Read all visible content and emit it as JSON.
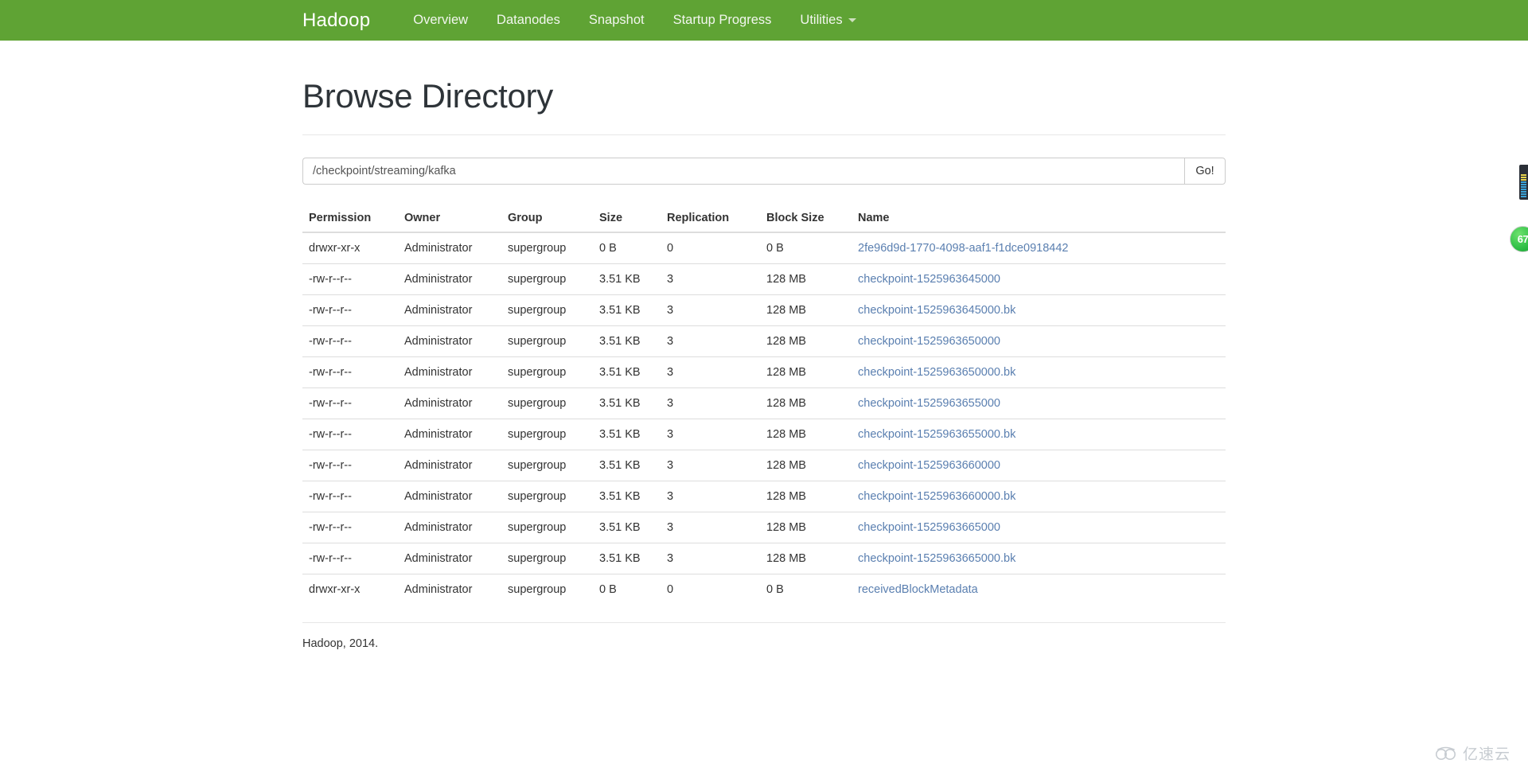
{
  "navbar": {
    "brand": "Hadoop",
    "items": [
      {
        "label": "Overview"
      },
      {
        "label": "Datanodes"
      },
      {
        "label": "Snapshot"
      },
      {
        "label": "Startup Progress"
      },
      {
        "label": "Utilities",
        "has_caret": true
      }
    ],
    "background_color": "#5fa334"
  },
  "page": {
    "title": "Browse Directory"
  },
  "path_bar": {
    "value": "/checkpoint/streaming/kafka",
    "placeholder": "Enter a path",
    "go_label": "Go!"
  },
  "table": {
    "headers": [
      "Permission",
      "Owner",
      "Group",
      "Size",
      "Replication",
      "Block Size",
      "Name"
    ],
    "rows": [
      {
        "permission": "drwxr-xr-x",
        "owner": "Administrator",
        "group": "supergroup",
        "size": "0 B",
        "replication": "0",
        "block_size": "0 B",
        "name": "2fe96d9d-1770-4098-aaf1-f1dce0918442"
      },
      {
        "permission": "-rw-r--r--",
        "owner": "Administrator",
        "group": "supergroup",
        "size": "3.51 KB",
        "replication": "3",
        "block_size": "128 MB",
        "name": "checkpoint-1525963645000"
      },
      {
        "permission": "-rw-r--r--",
        "owner": "Administrator",
        "group": "supergroup",
        "size": "3.51 KB",
        "replication": "3",
        "block_size": "128 MB",
        "name": "checkpoint-1525963645000.bk"
      },
      {
        "permission": "-rw-r--r--",
        "owner": "Administrator",
        "group": "supergroup",
        "size": "3.51 KB",
        "replication": "3",
        "block_size": "128 MB",
        "name": "checkpoint-1525963650000"
      },
      {
        "permission": "-rw-r--r--",
        "owner": "Administrator",
        "group": "supergroup",
        "size": "3.51 KB",
        "replication": "3",
        "block_size": "128 MB",
        "name": "checkpoint-1525963650000.bk"
      },
      {
        "permission": "-rw-r--r--",
        "owner": "Administrator",
        "group": "supergroup",
        "size": "3.51 KB",
        "replication": "3",
        "block_size": "128 MB",
        "name": "checkpoint-1525963655000"
      },
      {
        "permission": "-rw-r--r--",
        "owner": "Administrator",
        "group": "supergroup",
        "size": "3.51 KB",
        "replication": "3",
        "block_size": "128 MB",
        "name": "checkpoint-1525963655000.bk"
      },
      {
        "permission": "-rw-r--r--",
        "owner": "Administrator",
        "group": "supergroup",
        "size": "3.51 KB",
        "replication": "3",
        "block_size": "128 MB",
        "name": "checkpoint-1525963660000"
      },
      {
        "permission": "-rw-r--r--",
        "owner": "Administrator",
        "group": "supergroup",
        "size": "3.51 KB",
        "replication": "3",
        "block_size": "128 MB",
        "name": "checkpoint-1525963660000.bk"
      },
      {
        "permission": "-rw-r--r--",
        "owner": "Administrator",
        "group": "supergroup",
        "size": "3.51 KB",
        "replication": "3",
        "block_size": "128 MB",
        "name": "checkpoint-1525963665000"
      },
      {
        "permission": "-rw-r--r--",
        "owner": "Administrator",
        "group": "supergroup",
        "size": "3.51 KB",
        "replication": "3",
        "block_size": "128 MB",
        "name": "checkpoint-1525963665000.bk"
      },
      {
        "permission": "drwxr-xr-x",
        "owner": "Administrator",
        "group": "supergroup",
        "size": "0 B",
        "replication": "0",
        "block_size": "0 B",
        "name": "receivedBlockMetadata"
      }
    ]
  },
  "footer": {
    "text": "Hadoop, 2014."
  },
  "overlays": {
    "score_badge": "67",
    "watermark_text": "亿速云"
  }
}
